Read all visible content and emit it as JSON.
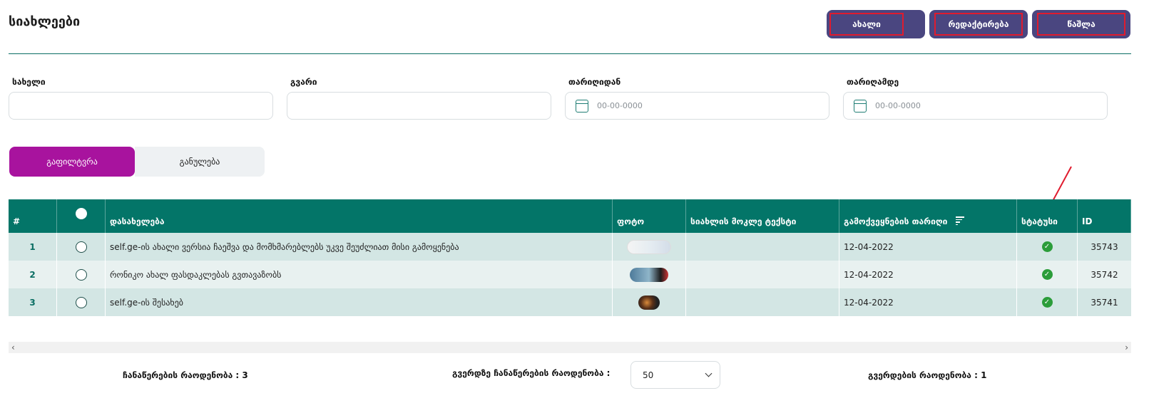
{
  "header": {
    "title": "სიახლეები",
    "actions": {
      "new_label": "ახალი",
      "edit_label": "რედაქტირება",
      "delete_label": "წაშლა"
    }
  },
  "filters": {
    "name": {
      "label": "სახელი",
      "value": ""
    },
    "surname": {
      "label": "გვარი",
      "value": ""
    },
    "date_from": {
      "label": "თარიღიდან",
      "placeholder": "00-00-0000"
    },
    "date_to": {
      "label": "თარიღამდე",
      "placeholder": "00-00-0000"
    }
  },
  "tabs": {
    "filter_label": "გაფილტვრა",
    "reset_label": "განულება"
  },
  "table": {
    "columns": {
      "num": "#",
      "title": "დასახელება",
      "photo": "ფოტო",
      "short_text": "სიახლის მოკლე ტექსტი",
      "date": "გამოქვეყნების თარიღი",
      "status": "სტატუსი",
      "id": "ID"
    },
    "rows": [
      {
        "num": "1",
        "title": "self.ge-ის ახალი ვერსია ჩაეშვა და მომხმარებლებს უკვე შეუძლიათ მისი გამოყენება",
        "short_text": "",
        "date": "12-04-2022",
        "id": "35743"
      },
      {
        "num": "2",
        "title": "რონიკო ახალ ფასდაკლებას გვთავაზობს",
        "short_text": "",
        "date": "12-04-2022",
        "id": "35742"
      },
      {
        "num": "3",
        "title": "self.ge-ის შესახებ",
        "short_text": "",
        "date": "12-04-2022",
        "id": "35741"
      }
    ]
  },
  "footer": {
    "records_count": "ჩანაწერების რაოდენობა : 3",
    "per_page_label": "გვერდზე ჩანაწერების რაოდენობა :",
    "per_page_value": "50",
    "pages_count": "გვერდების რაოდენობა : 1"
  },
  "colors": {
    "accent": "#037568",
    "action_button": "#4a4680",
    "filter_tab": "#a8139e",
    "highlight_border": "#e01b2e",
    "status_ok": "#2b9d3a"
  },
  "icons": {
    "date_picker": "calendar-icon",
    "status": "check-circle-icon",
    "sort": "sort-icon"
  }
}
